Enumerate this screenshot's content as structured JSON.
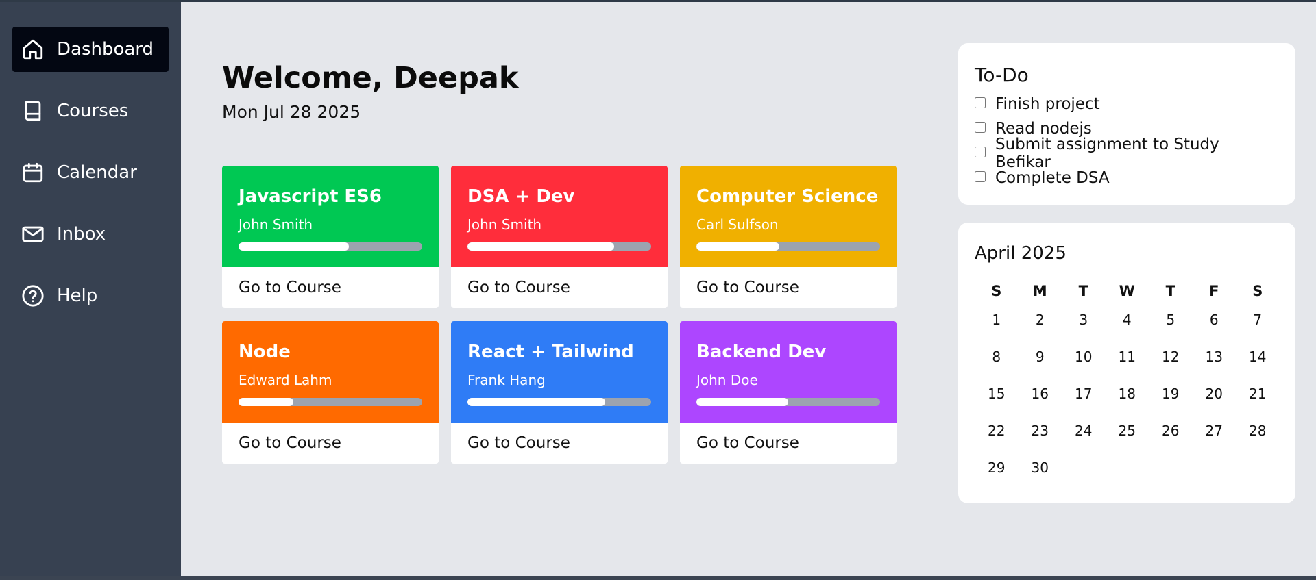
{
  "sidebar": {
    "items": [
      {
        "label": "Dashboard",
        "icon": "home-icon",
        "active": true
      },
      {
        "label": "Courses",
        "icon": "book-icon",
        "active": false
      },
      {
        "label": "Calendar",
        "icon": "calendar-icon",
        "active": false
      },
      {
        "label": "Inbox",
        "icon": "mail-icon",
        "active": false
      },
      {
        "label": "Help",
        "icon": "help-circle-icon",
        "active": false
      }
    ]
  },
  "header": {
    "welcome": "Welcome, Deepak",
    "date": "Mon Jul 28 2025"
  },
  "courses": [
    {
      "title": "Javascript ES6",
      "author": "John Smith",
      "color": "#00c853",
      "progress": 0.6,
      "cta": "Go to Course"
    },
    {
      "title": "DSA + Dev",
      "author": "John Smith",
      "color": "#ff2d3b",
      "progress": 0.8,
      "cta": "Go to Course"
    },
    {
      "title": "Computer Science",
      "author": "Carl Sulfson",
      "color": "#f0b000",
      "progress": 0.45,
      "cta": "Go to Course"
    },
    {
      "title": "Node",
      "author": "Edward Lahm",
      "color": "#ff6a00",
      "progress": 0.3,
      "cta": "Go to Course"
    },
    {
      "title": "React + Tailwind",
      "author": "Frank Hang",
      "color": "#2f7cf6",
      "progress": 0.75,
      "cta": "Go to Course"
    },
    {
      "title": "Backend Dev",
      "author": "John Doe",
      "color": "#ad46ff",
      "progress": 0.5,
      "cta": "Go to Course"
    }
  ],
  "todo": {
    "title": "To-Do",
    "items": [
      {
        "label": "Finish project",
        "checked": false
      },
      {
        "label": "Read nodejs",
        "checked": false
      },
      {
        "label": "Submit assignment to Study Befikar",
        "checked": false
      },
      {
        "label": "Complete DSA",
        "checked": false
      }
    ]
  },
  "calendar": {
    "title": "April 2025",
    "weekdays": [
      "S",
      "M",
      "T",
      "W",
      "T",
      "F",
      "S"
    ],
    "days": [
      "1",
      "2",
      "3",
      "4",
      "5",
      "6",
      "7",
      "8",
      "9",
      "10",
      "11",
      "12",
      "13",
      "14",
      "15",
      "16",
      "17",
      "18",
      "19",
      "20",
      "21",
      "22",
      "23",
      "24",
      "25",
      "26",
      "27",
      "28",
      "29",
      "30"
    ]
  },
  "colors": {
    "sidebar_bg": "#374151",
    "active_nav_bg": "#030712",
    "main_bg": "#e5e7eb",
    "progress_track": "#9ca3af"
  }
}
